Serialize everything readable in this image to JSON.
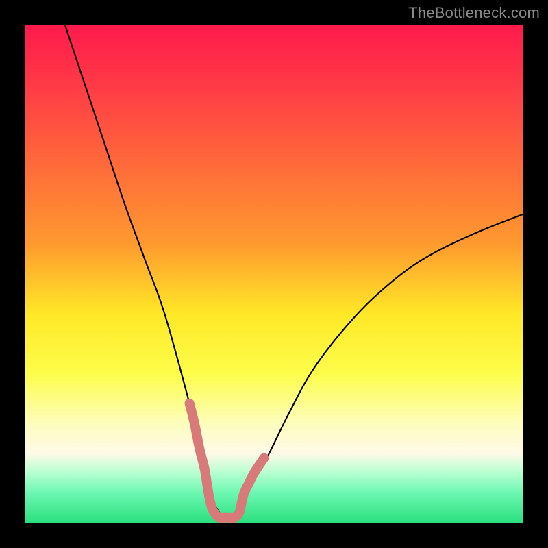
{
  "watermark": "TheBottleneck.com",
  "chart_data": {
    "type": "line",
    "title": "",
    "xlabel": "",
    "ylabel": "",
    "xlim": [
      0,
      100
    ],
    "ylim": [
      0,
      100
    ],
    "grid": false,
    "series": [
      {
        "name": "bottleneck-curve",
        "color": "#000000",
        "x": [
          8,
          12,
          16,
          20,
          24,
          28,
          33,
          36,
          37,
          40,
          43,
          44,
          48,
          53,
          58,
          65,
          72,
          80,
          90,
          100
        ],
        "values": [
          100,
          88,
          76,
          64,
          53,
          42,
          24,
          12,
          6,
          1,
          1,
          6,
          12,
          22,
          31,
          40,
          47,
          53,
          58,
          62
        ]
      },
      {
        "name": "optimal-zone-marker",
        "color": "#d87a7a",
        "x": [
          33,
          34,
          35,
          36,
          36.5,
          37,
          37.5,
          38,
          39,
          40,
          41,
          42,
          43,
          43.5,
          44,
          45,
          46,
          48
        ],
        "values": [
          24,
          20,
          15,
          11,
          8,
          5,
          3,
          2,
          1,
          1,
          1,
          1,
          2,
          4,
          6,
          8,
          10,
          13
        ]
      }
    ],
    "background_gradient": {
      "orientation": "vertical",
      "stops": [
        {
          "pos": 0.0,
          "color": "#ff1a4c"
        },
        {
          "pos": 0.58,
          "color": "#ffe827"
        },
        {
          "pos": 0.86,
          "color": "#fff9e8"
        },
        {
          "pos": 1.0,
          "color": "#2be07f"
        }
      ]
    }
  }
}
